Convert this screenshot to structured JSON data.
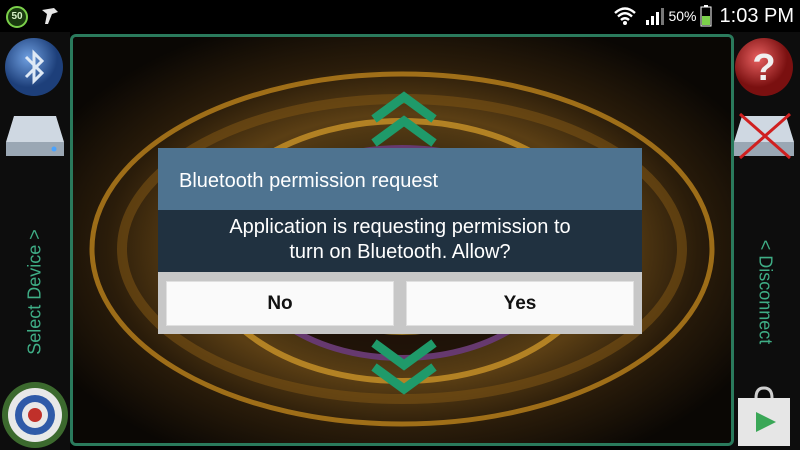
{
  "status_bar": {
    "badge": "50",
    "app_icon": "usb-debug-icon",
    "wifi_icon": "wifi-icon",
    "signal_icon": "signal-icon",
    "battery_percent": "50%",
    "battery_icon": "battery-icon",
    "time": "1:03 PM"
  },
  "left_panel": {
    "bluetooth_icon": "bluetooth-icon",
    "device_icon": "drive-icon",
    "label": "Select Device >",
    "target_icon": "target-icon"
  },
  "right_panel": {
    "help_icon": "help-icon",
    "disconnect_icon": "drive-disconnected-icon",
    "label": "< Disconnect",
    "store_icon": "play-store-icon"
  },
  "main": {
    "up_icon": "chevron-up-icon",
    "down_icon": "chevron-down-icon"
  },
  "dialog": {
    "title": "Bluetooth permission request",
    "message_line1": "Application is requesting permission to",
    "message_line2": "turn on Bluetooth. Allow?",
    "no_label": "No",
    "yes_label": "Yes"
  },
  "colors": {
    "accent_green": "#3fae86",
    "dialog_title_bg": "#4e7390",
    "dialog_body_bg": "#203140"
  }
}
